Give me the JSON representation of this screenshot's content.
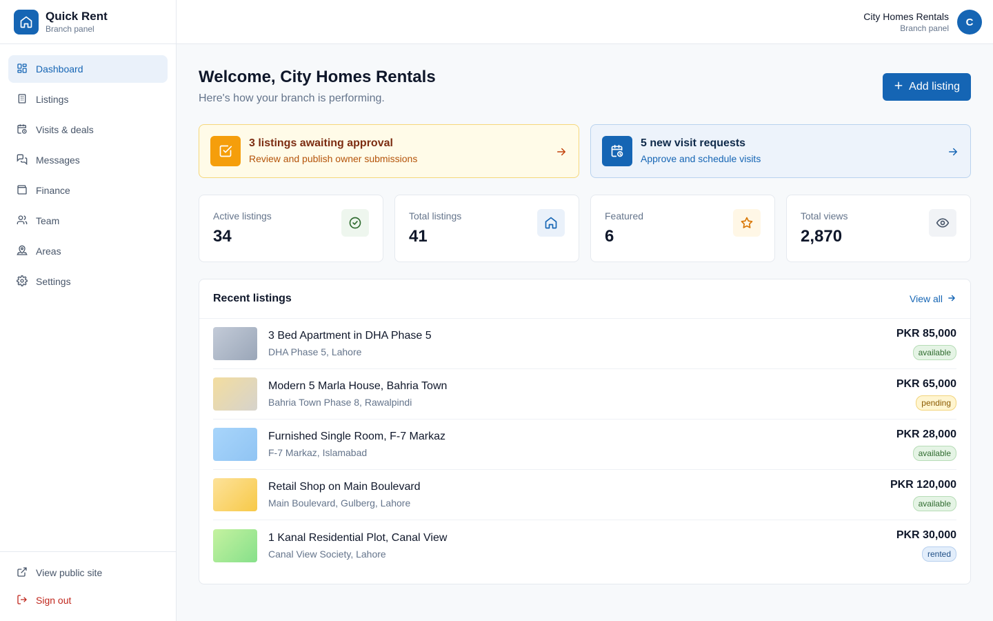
{
  "brand": {
    "name": "Quick Rent",
    "subtitle": "Branch panel"
  },
  "sidebar": {
    "items": [
      {
        "label": "Dashboard",
        "icon": "dashboard-icon",
        "active": true
      },
      {
        "label": "Listings",
        "icon": "building-icon"
      },
      {
        "label": "Visits & deals",
        "icon": "calendar-clock-icon"
      },
      {
        "label": "Messages",
        "icon": "messages-icon"
      },
      {
        "label": "Finance",
        "icon": "wallet-icon"
      },
      {
        "label": "Team",
        "icon": "users-icon"
      },
      {
        "label": "Areas",
        "icon": "map-pin-icon"
      },
      {
        "label": "Settings",
        "icon": "gear-icon"
      }
    ],
    "bottom": [
      {
        "label": "View public site",
        "icon": "external-link-icon"
      },
      {
        "label": "Sign out",
        "icon": "sign-out-icon"
      }
    ]
  },
  "topbar": {
    "user_name": "City Homes Rentals",
    "user_sub": "Branch panel",
    "avatar_initial": "C"
  },
  "header": {
    "title": "Welcome, City Homes Rentals",
    "subtitle": "Here's how your branch is performing.",
    "add_label": "Add listing"
  },
  "alerts": [
    {
      "title": "3 listings awaiting approval",
      "subtitle": "Review and publish owner submissions",
      "tone": "amber",
      "icon": "checkbox-icon"
    },
    {
      "title": "5 new visit requests",
      "subtitle": "Approve and schedule visits",
      "tone": "blue",
      "icon": "calendar-clock-icon"
    }
  ],
  "stats": [
    {
      "label": "Active listings",
      "value": "34",
      "icon": "check-circle-icon",
      "color": "#2f6b2f",
      "bg": "#eef6ee"
    },
    {
      "label": "Total listings",
      "value": "41",
      "icon": "home-icon",
      "color": "#1565b4",
      "bg": "#eaf1fa"
    },
    {
      "label": "Featured",
      "value": "6",
      "icon": "star-icon",
      "color": "#d97706",
      "bg": "#fff7e6"
    },
    {
      "label": "Total views",
      "value": "2,870",
      "icon": "eye-icon",
      "color": "#475569",
      "bg": "#f1f3f6"
    }
  ],
  "recent": {
    "title": "Recent listings",
    "view_all": "View all",
    "rows": [
      {
        "title": "3 Bed Apartment in DHA Phase 5",
        "location": "DHA Phase 5, Lahore",
        "price": "PKR 85,000",
        "status": "available",
        "thumb": [
          "#c3cbd8",
          "#9aa6b8"
        ]
      },
      {
        "title": "Modern 5 Marla House, Bahria Town",
        "location": "Bahria Town Phase 8, Rawalpindi",
        "price": "PKR 65,000",
        "status": "pending",
        "thumb": [
          "#f3dd9f",
          "#d6d3cc"
        ]
      },
      {
        "title": "Furnished Single Room, F-7 Markaz",
        "location": "F-7 Markaz, Islamabad",
        "price": "PKR 28,000",
        "status": "available",
        "thumb": [
          "#a8d5fb",
          "#90c4f3"
        ]
      },
      {
        "title": "Retail Shop on Main Boulevard",
        "location": "Main Boulevard, Gulberg, Lahore",
        "price": "PKR 120,000",
        "status": "available",
        "thumb": [
          "#fde29a",
          "#f7c948"
        ]
      },
      {
        "title": "1 Kanal Residential Plot, Canal View",
        "location": "Canal View Society, Lahore",
        "price": "PKR 30,000",
        "status": "rented",
        "thumb": [
          "#c5f2a0",
          "#86e08a"
        ]
      }
    ]
  }
}
